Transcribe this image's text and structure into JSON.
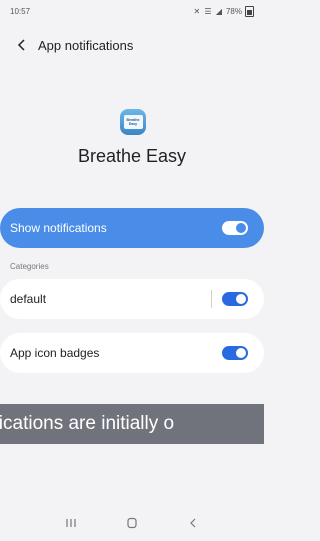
{
  "status_bar": {
    "time": "10:57",
    "icons": "✕ ☰ ◢",
    "battery": "78%"
  },
  "header": {
    "title": "App notifications",
    "back_icon": "chevron-left-icon"
  },
  "app": {
    "name": "Breathe Easy",
    "logo_line1": "Breathe",
    "logo_line2": "Easy"
  },
  "settings": {
    "show_notifications": {
      "label": "Show notifications",
      "enabled": true
    },
    "categories_label": "Categories",
    "default": {
      "label": "default",
      "enabled": true
    },
    "app_icon_badges": {
      "label": "App icon badges",
      "enabled": true
    }
  },
  "caption": "tifications are initially o",
  "nav": {
    "recents_icon": "recents-icon",
    "home_icon": "home-icon",
    "back_icon": "back-icon"
  },
  "colors": {
    "accent": "#4a8de8",
    "toggle": "#2a6ae0",
    "background": "#f3f3f5",
    "banner": "#686c75"
  }
}
